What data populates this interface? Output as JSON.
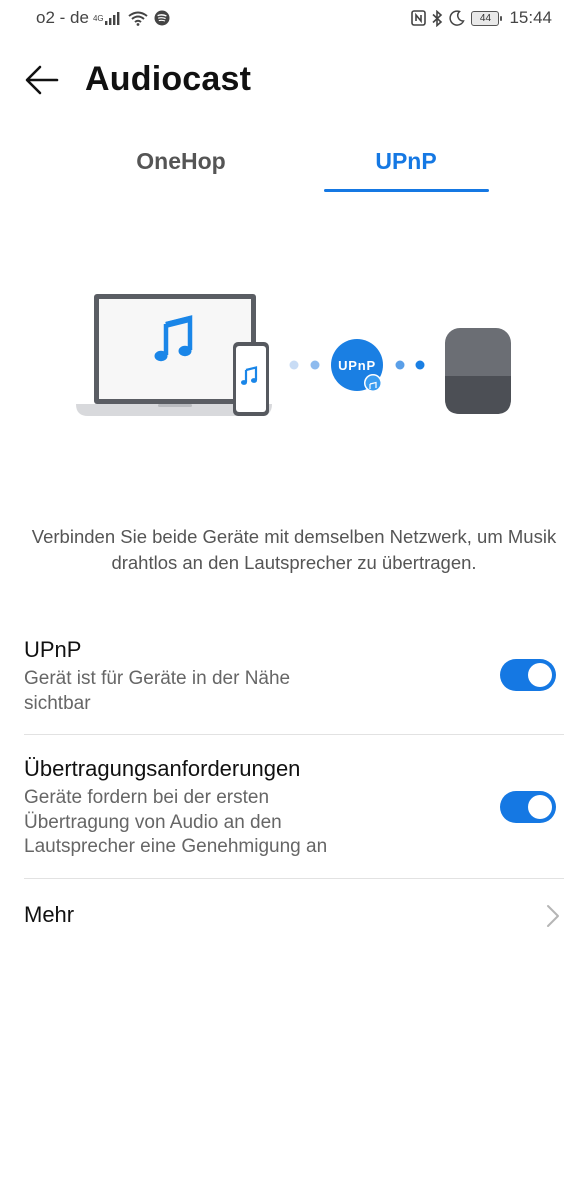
{
  "status_bar": {
    "carrier": "o2 - de",
    "network_type": "4G",
    "battery": "44",
    "time": "15:44",
    "icons_left": [
      "signal-icon",
      "wifi-icon",
      "spotify-icon"
    ],
    "icons_right": [
      "nfc-icon",
      "bluetooth-icon",
      "moon-icon",
      "battery-icon"
    ]
  },
  "header": {
    "title": "Audiocast",
    "back_icon": "arrow-left-icon"
  },
  "tabs": [
    {
      "label": "OneHop",
      "active": false
    },
    {
      "label": "UPnP",
      "active": true
    }
  ],
  "illustration": {
    "badge_label": "UPnP"
  },
  "description": "Verbinden Sie beide Geräte mit demselben Netzwerk, um Musik drahtlos an den Lautsprecher zu übertragen.",
  "settings": [
    {
      "title": "UPnP",
      "subtitle": "Gerät ist für Geräte in der Nähe sichtbar",
      "enabled": true
    },
    {
      "title": "Übertragungsanforderungen",
      "subtitle": "Geräte fordern bei der ersten Übertragung von Audio an den Lautsprecher eine Genehmigung an",
      "enabled": true
    }
  ],
  "more": {
    "label": "Mehr"
  },
  "colors": {
    "accent": "#1578e3",
    "title_text": "#111111",
    "secondary_text": "#666666",
    "divider": "#e2e2e2"
  }
}
